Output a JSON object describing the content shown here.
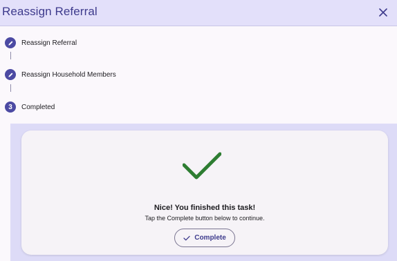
{
  "header": {
    "title": "Reassign Referral",
    "close_icon": "close-icon"
  },
  "stepper": {
    "steps": [
      {
        "label": "Reassign Referral",
        "icon": "pencil-icon"
      },
      {
        "label": "Reassign Household Members",
        "icon": "pencil-icon"
      },
      {
        "label": "Completed",
        "number": "3"
      }
    ]
  },
  "card": {
    "icon": "checkmark-icon",
    "title": "Nice! You finished this task!",
    "subtitle": "Tap the Complete button below to continue.",
    "button_label": "Complete",
    "button_icon": "check-icon"
  },
  "colors": {
    "header_bg": "#e3e0fa",
    "accent": "#3d3a8c",
    "step_circle": "#4c4aa3",
    "success_green": "#2e7d32",
    "lower_bg": "#dddbf7",
    "card_bg": "#f6f3f7"
  }
}
